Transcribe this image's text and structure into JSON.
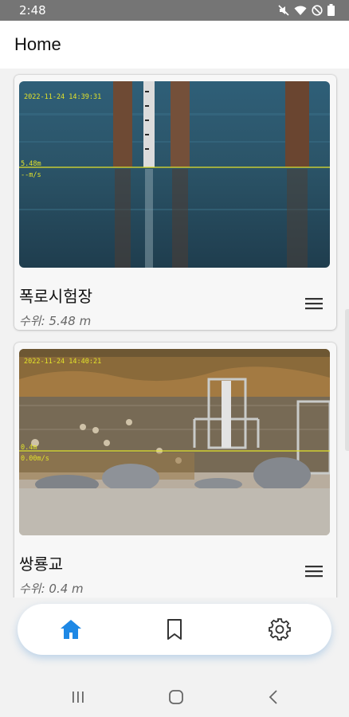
{
  "status_bar": {
    "time": "2:48",
    "icons": [
      "mute-icon",
      "wifi-icon",
      "do-not-disturb-icon",
      "battery-icon"
    ]
  },
  "app_bar": {
    "title": "Home"
  },
  "cards": [
    {
      "name": "폭로시험장",
      "level": "수위: 5.48 m",
      "overlay_timestamp": "2022-11-24 14:39:31",
      "overlay_level": "5.48m",
      "overlay_speed": "--m/s"
    },
    {
      "name": "쌍룡교",
      "level": "수위: 0.4 m",
      "overlay_timestamp": "2022-11-24 14:40:21",
      "overlay_level": "0.4m",
      "overlay_speed": "0.00m/s"
    }
  ],
  "bottom_nav": {
    "items": [
      {
        "icon": "home-icon",
        "active": true
      },
      {
        "icon": "bookmark-icon",
        "active": false
      },
      {
        "icon": "gear-icon",
        "active": false
      }
    ],
    "active_color": "#1e88e5",
    "inactive_color": "#333333"
  },
  "system_nav": [
    "recent-apps-icon",
    "home-circle-icon",
    "back-icon"
  ]
}
